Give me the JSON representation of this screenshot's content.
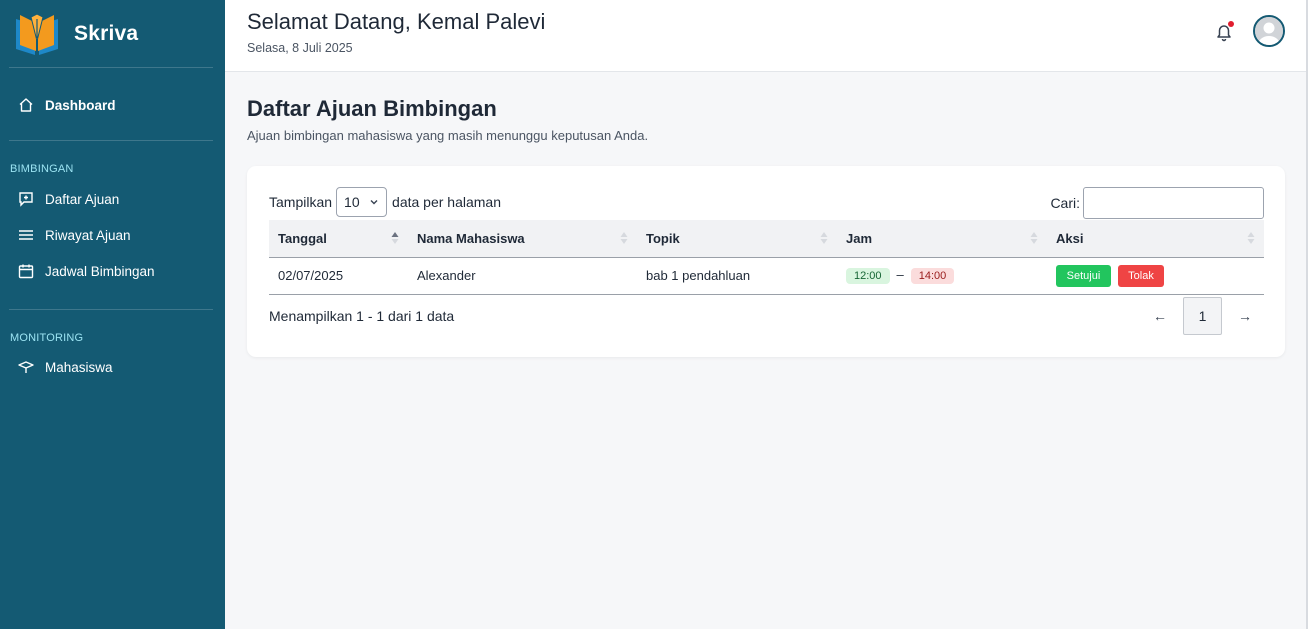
{
  "brand": {
    "name": "Skriva",
    "logo_icon": "book-pen-logo"
  },
  "sidebar": {
    "dashboard": "Dashboard",
    "section_bimbingan": "BIMBINGAN",
    "bimbingan_items": [
      "Daftar Ajuan",
      "Riwayat Ajuan",
      "Jadwal Bimbingan"
    ],
    "section_monitoring": "MONITORING",
    "monitoring_items": [
      "Mahasiswa"
    ]
  },
  "header": {
    "welcome": "Selamat Datang, Kemal Palevi",
    "date": "Selasa, 8 Juli 2025"
  },
  "main": {
    "title": "Daftar Ajuan Bimbingan",
    "subtitle": "Ajuan bimbingan mahasiswa yang masih menunggu keputusan Anda."
  },
  "table_controls": {
    "show_prefix": "Tampilkan",
    "page_length": "10",
    "show_suffix": "data per halaman",
    "search_label": "Cari:",
    "search_value": ""
  },
  "table": {
    "headers": [
      "Tanggal",
      "Nama Mahasiswa",
      "Topik",
      "Jam",
      "Aksi"
    ],
    "rows": [
      {
        "tanggal": "02/07/2025",
        "nama": "Alexander",
        "topik": "bab 1 pendahluan",
        "jam_mulai": "12:00",
        "jam_sep": "–",
        "jam_selesai": "14:00",
        "approve": "Setujui",
        "reject": "Tolak"
      }
    ]
  },
  "footer": {
    "info": "Menampilkan 1 - 1 dari 1 data",
    "prev": "←",
    "current_page": "1",
    "next": "→"
  },
  "colors": {
    "sidebar_bg": "#145a73",
    "approve": "#22c55e",
    "reject": "#ef4444",
    "notification_dot": "#e11d2e"
  }
}
